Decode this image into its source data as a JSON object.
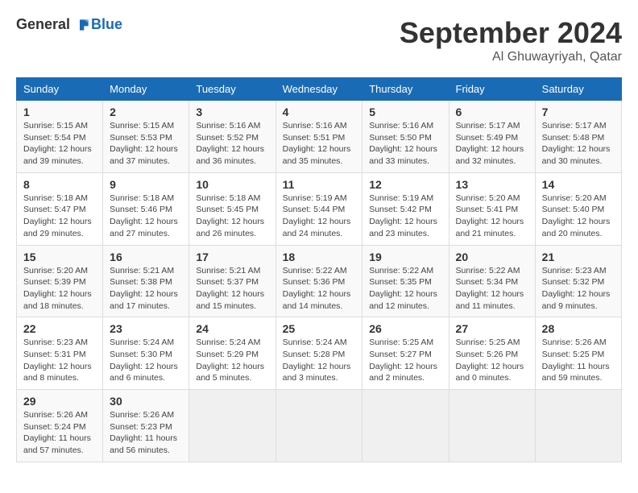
{
  "header": {
    "logo_general": "General",
    "logo_blue": "Blue",
    "month_title": "September 2024",
    "location": "Al Ghuwayriyah, Qatar"
  },
  "calendar": {
    "columns": [
      "Sunday",
      "Monday",
      "Tuesday",
      "Wednesday",
      "Thursday",
      "Friday",
      "Saturday"
    ],
    "weeks": [
      [
        null,
        {
          "day": "2",
          "sunrise": "5:15 AM",
          "sunset": "5:53 PM",
          "daylight": "12 hours and 37 minutes."
        },
        {
          "day": "3",
          "sunrise": "5:16 AM",
          "sunset": "5:52 PM",
          "daylight": "12 hours and 36 minutes."
        },
        {
          "day": "4",
          "sunrise": "5:16 AM",
          "sunset": "5:51 PM",
          "daylight": "12 hours and 35 minutes."
        },
        {
          "day": "5",
          "sunrise": "5:16 AM",
          "sunset": "5:50 PM",
          "daylight": "12 hours and 33 minutes."
        },
        {
          "day": "6",
          "sunrise": "5:17 AM",
          "sunset": "5:49 PM",
          "daylight": "12 hours and 32 minutes."
        },
        {
          "day": "7",
          "sunrise": "5:17 AM",
          "sunset": "5:48 PM",
          "daylight": "12 hours and 30 minutes."
        }
      ],
      [
        {
          "day": "1",
          "sunrise": "5:15 AM",
          "sunset": "5:54 PM",
          "daylight": "12 hours and 39 minutes."
        },
        {
          "day": "9",
          "sunrise": "5:18 AM",
          "sunset": "5:46 PM",
          "daylight": "12 hours and 27 minutes."
        },
        {
          "day": "10",
          "sunrise": "5:18 AM",
          "sunset": "5:45 PM",
          "daylight": "12 hours and 26 minutes."
        },
        {
          "day": "11",
          "sunrise": "5:19 AM",
          "sunset": "5:44 PM",
          "daylight": "12 hours and 24 minutes."
        },
        {
          "day": "12",
          "sunrise": "5:19 AM",
          "sunset": "5:42 PM",
          "daylight": "12 hours and 23 minutes."
        },
        {
          "day": "13",
          "sunrise": "5:20 AM",
          "sunset": "5:41 PM",
          "daylight": "12 hours and 21 minutes."
        },
        {
          "day": "14",
          "sunrise": "5:20 AM",
          "sunset": "5:40 PM",
          "daylight": "12 hours and 20 minutes."
        }
      ],
      [
        {
          "day": "8",
          "sunrise": "5:18 AM",
          "sunset": "5:47 PM",
          "daylight": "12 hours and 29 minutes."
        },
        {
          "day": "16",
          "sunrise": "5:21 AM",
          "sunset": "5:38 PM",
          "daylight": "12 hours and 17 minutes."
        },
        {
          "day": "17",
          "sunrise": "5:21 AM",
          "sunset": "5:37 PM",
          "daylight": "12 hours and 15 minutes."
        },
        {
          "day": "18",
          "sunrise": "5:22 AM",
          "sunset": "5:36 PM",
          "daylight": "12 hours and 14 minutes."
        },
        {
          "day": "19",
          "sunrise": "5:22 AM",
          "sunset": "5:35 PM",
          "daylight": "12 hours and 12 minutes."
        },
        {
          "day": "20",
          "sunrise": "5:22 AM",
          "sunset": "5:34 PM",
          "daylight": "12 hours and 11 minutes."
        },
        {
          "day": "21",
          "sunrise": "5:23 AM",
          "sunset": "5:32 PM",
          "daylight": "12 hours and 9 minutes."
        }
      ],
      [
        {
          "day": "15",
          "sunrise": "5:20 AM",
          "sunset": "5:39 PM",
          "daylight": "12 hours and 18 minutes."
        },
        {
          "day": "23",
          "sunrise": "5:24 AM",
          "sunset": "5:30 PM",
          "daylight": "12 hours and 6 minutes."
        },
        {
          "day": "24",
          "sunrise": "5:24 AM",
          "sunset": "5:29 PM",
          "daylight": "12 hours and 5 minutes."
        },
        {
          "day": "25",
          "sunrise": "5:24 AM",
          "sunset": "5:28 PM",
          "daylight": "12 hours and 3 minutes."
        },
        {
          "day": "26",
          "sunrise": "5:25 AM",
          "sunset": "5:27 PM",
          "daylight": "12 hours and 2 minutes."
        },
        {
          "day": "27",
          "sunrise": "5:25 AM",
          "sunset": "5:26 PM",
          "daylight": "12 hours and 0 minutes."
        },
        {
          "day": "28",
          "sunrise": "5:26 AM",
          "sunset": "5:25 PM",
          "daylight": "11 hours and 59 minutes."
        }
      ],
      [
        {
          "day": "22",
          "sunrise": "5:23 AM",
          "sunset": "5:31 PM",
          "daylight": "12 hours and 8 minutes."
        },
        {
          "day": "30",
          "sunrise": "5:26 AM",
          "sunset": "5:23 PM",
          "daylight": "11 hours and 56 minutes."
        },
        null,
        null,
        null,
        null,
        null
      ],
      [
        {
          "day": "29",
          "sunrise": "5:26 AM",
          "sunset": "5:24 PM",
          "daylight": "11 hours and 57 minutes."
        },
        null,
        null,
        null,
        null,
        null,
        null
      ]
    ]
  }
}
